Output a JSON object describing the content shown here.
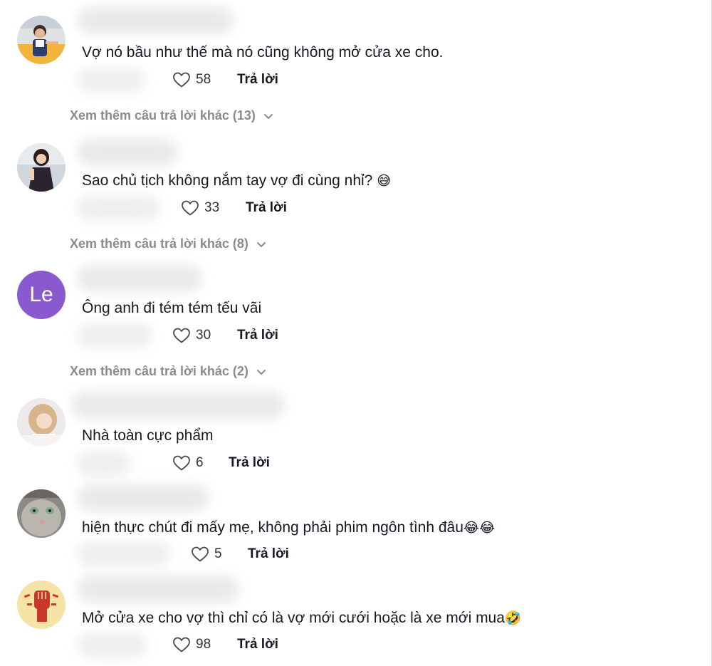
{
  "reply_label": "Trả lời",
  "comments": [
    {
      "text": "Vợ nó bầu như thế mà nó cũng không mở cửa xe cho.",
      "likes": "58",
      "more_replies": "Xem thêm câu trả lời khác (13)"
    },
    {
      "text": "Sao chủ tịch không nắm tay vợ đi cùng nhỉ?",
      "emoji": "😅",
      "likes": "33",
      "more_replies": "Xem thêm câu trả lời khác (8)"
    },
    {
      "avatar_letter": "Le",
      "text": "Ông anh đi tém tém tếu vãi",
      "likes": "30",
      "more_replies": "Xem thêm câu trả lời khác (2)"
    },
    {
      "text": "Nhà toàn cực phẩm",
      "likes": "6"
    },
    {
      "text": "hiện thực chút đi mấy mẹ, không phải phim ngôn tình đâu",
      "emoji": "😂😂",
      "likes": "5"
    },
    {
      "text": "Mở cửa xe cho vợ thì chỉ có là vợ mới cưới hoặc là xe mới mua",
      "emoji": "🤣",
      "likes": "98"
    }
  ],
  "colors": {
    "avatar_le": "#8a59d0",
    "more_replies_text": "#8a8b91",
    "heart_stroke": "#4a4a4a"
  },
  "icons": [
    "heart-icon",
    "chevron-down-icon"
  ]
}
